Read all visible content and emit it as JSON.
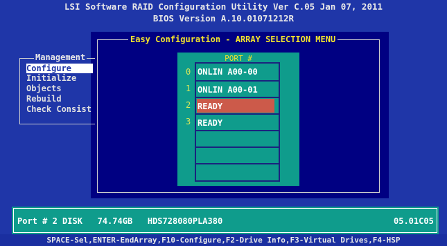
{
  "header": {
    "line1": "LSI Software RAID Configuration Utility Ver C.05 Jan 07, 2011",
    "line2": "BIOS Version   A.10.01071212R"
  },
  "easy_config": {
    "title": "Easy Configuration - ARRAY SELECTION MENU",
    "port_header": "PORT #",
    "slots": [
      {
        "num": "0",
        "label": "ONLIN A00-00",
        "highlighted": false
      },
      {
        "num": "1",
        "label": "ONLIN A00-01",
        "highlighted": false
      },
      {
        "num": "2",
        "label": "READY",
        "highlighted": true
      },
      {
        "num": "3",
        "label": "READY",
        "highlighted": false
      },
      {
        "num": "",
        "label": "",
        "highlighted": false
      },
      {
        "num": "",
        "label": "",
        "highlighted": false
      }
    ]
  },
  "management": {
    "title": "Management",
    "items": [
      "Configure",
      "Initialize",
      "Objects",
      "Rebuild",
      "Check Consist"
    ],
    "selected_index": 0
  },
  "status": {
    "port_info": "Port # 2 DISK   74.74GB   HDS728080PLA380",
    "version": "05.01C05"
  },
  "footer": {
    "keys": "SPACE-Sel,ENTER-EndArray,F10-Configure,F2-Drive Info,F3-Virtual Drives,F4-HSP"
  },
  "colors": {
    "background": "#1F36A8",
    "window": "#000082",
    "panel_teal": "#0f9c8c",
    "title_yellow": "#f2e22c",
    "highlight": "#cc5a4a"
  }
}
